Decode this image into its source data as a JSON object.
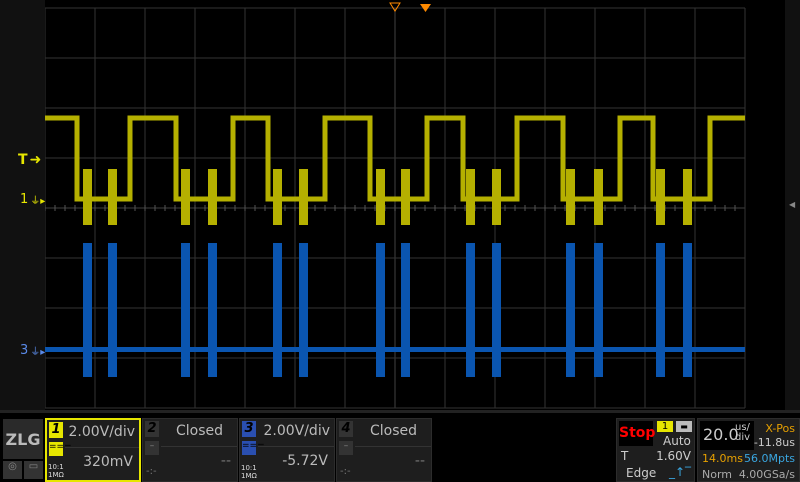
{
  "colors": {
    "ch1": "#b5b000",
    "ch3": "#0a55b0",
    "trigger": "#ff8a00",
    "grid": "#333"
  },
  "markers": {
    "trigger": "T",
    "ch1": "1",
    "ch3": "3"
  },
  "waveform_ch1": {
    "falls_div": [
      0.64,
      2.62,
      4.46,
      6.5,
      8.36,
      10.36,
      12.16
    ],
    "rises_div": [
      1.7,
      3.76,
      5.6,
      7.64,
      9.44,
      11.5,
      13.3
    ],
    "bursts_div": [
      0.84,
      1.34,
      2.8,
      3.34,
      4.64,
      5.16,
      6.7,
      7.2,
      8.5,
      9.02,
      10.5,
      11.06,
      12.3,
      12.84
    ],
    "high_div": 1.8,
    "low_div": 0.18
  },
  "waveform_ch3": {
    "baseline_div": -2.84,
    "bursts_div": [
      0.84,
      1.34,
      2.8,
      3.34,
      4.64,
      5.16,
      6.7,
      7.2,
      8.5,
      9.02,
      10.5,
      11.06,
      12.3,
      12.84
    ]
  },
  "logo": "ZLG",
  "channels": [
    {
      "num": "1",
      "scale": "2.00V/div",
      "offset": "320mV",
      "probe1": "10:1",
      "probe2": "1MΩ",
      "coupling": "==="
    },
    {
      "num": "2",
      "scale": "Closed",
      "offset": "--",
      "coupling": "–",
      "dim": "-:-"
    },
    {
      "num": "3",
      "scale": "2.00V/div",
      "offset": "-5.72V",
      "probe1": "10:1",
      "probe2": "1MΩ",
      "coupling": "==="
    },
    {
      "num": "4",
      "scale": "Closed",
      "offset": "--",
      "coupling": "–",
      "dim": "-:-"
    }
  ],
  "trigger": {
    "state": "Stop",
    "source": "1",
    "mode": "Auto",
    "label": "T",
    "level": "1.60V",
    "type": "Edge"
  },
  "timebase": {
    "scale": "20.0",
    "unit_top": "us/",
    "unit_bottom": "div",
    "xpos_label": "X-Pos",
    "xpos": "-11.8us",
    "window": "14.0ms",
    "memory": "56.0Mpts",
    "acq_mode": "Norm",
    "sample_rate": "4.00GSa/s"
  }
}
